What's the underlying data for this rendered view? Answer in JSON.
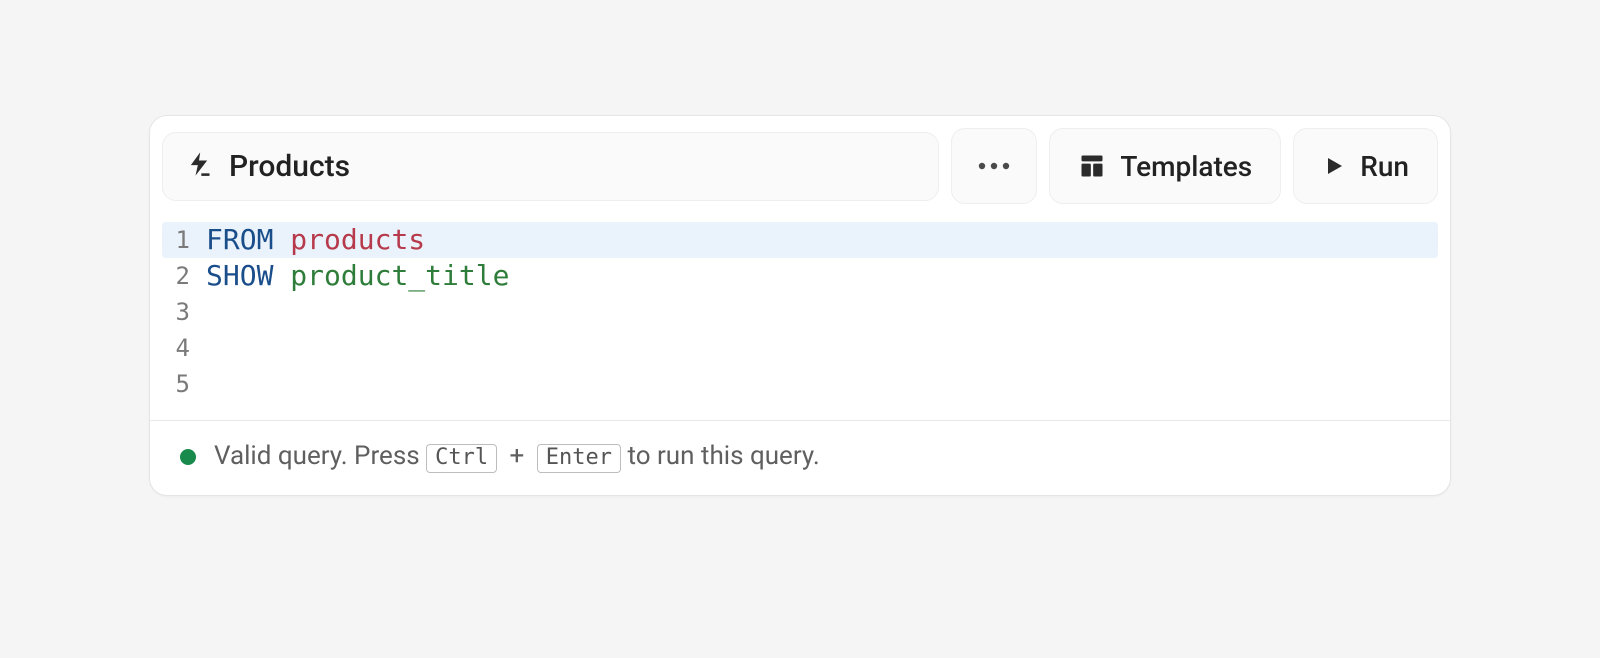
{
  "header": {
    "title": "Products",
    "templates_label": "Templates",
    "run_label": "Run"
  },
  "editor": {
    "highlighted_line": 1,
    "lines": [
      {
        "n": 1,
        "tokens": [
          {
            "t": "FROM",
            "c": "kw"
          },
          {
            "t": " ",
            "c": ""
          },
          {
            "t": "products",
            "c": "tbl"
          }
        ]
      },
      {
        "n": 2,
        "tokens": [
          {
            "t": "SHOW",
            "c": "kw"
          },
          {
            "t": " ",
            "c": ""
          },
          {
            "t": "product_title",
            "c": "col"
          }
        ]
      },
      {
        "n": 3,
        "tokens": []
      },
      {
        "n": 4,
        "tokens": []
      },
      {
        "n": 5,
        "tokens": []
      }
    ]
  },
  "status": {
    "ok": true,
    "prefix": "Valid query. Press ",
    "key1": "Ctrl",
    "plus": "+",
    "key2": "Enter",
    "suffix": " to run this query."
  }
}
